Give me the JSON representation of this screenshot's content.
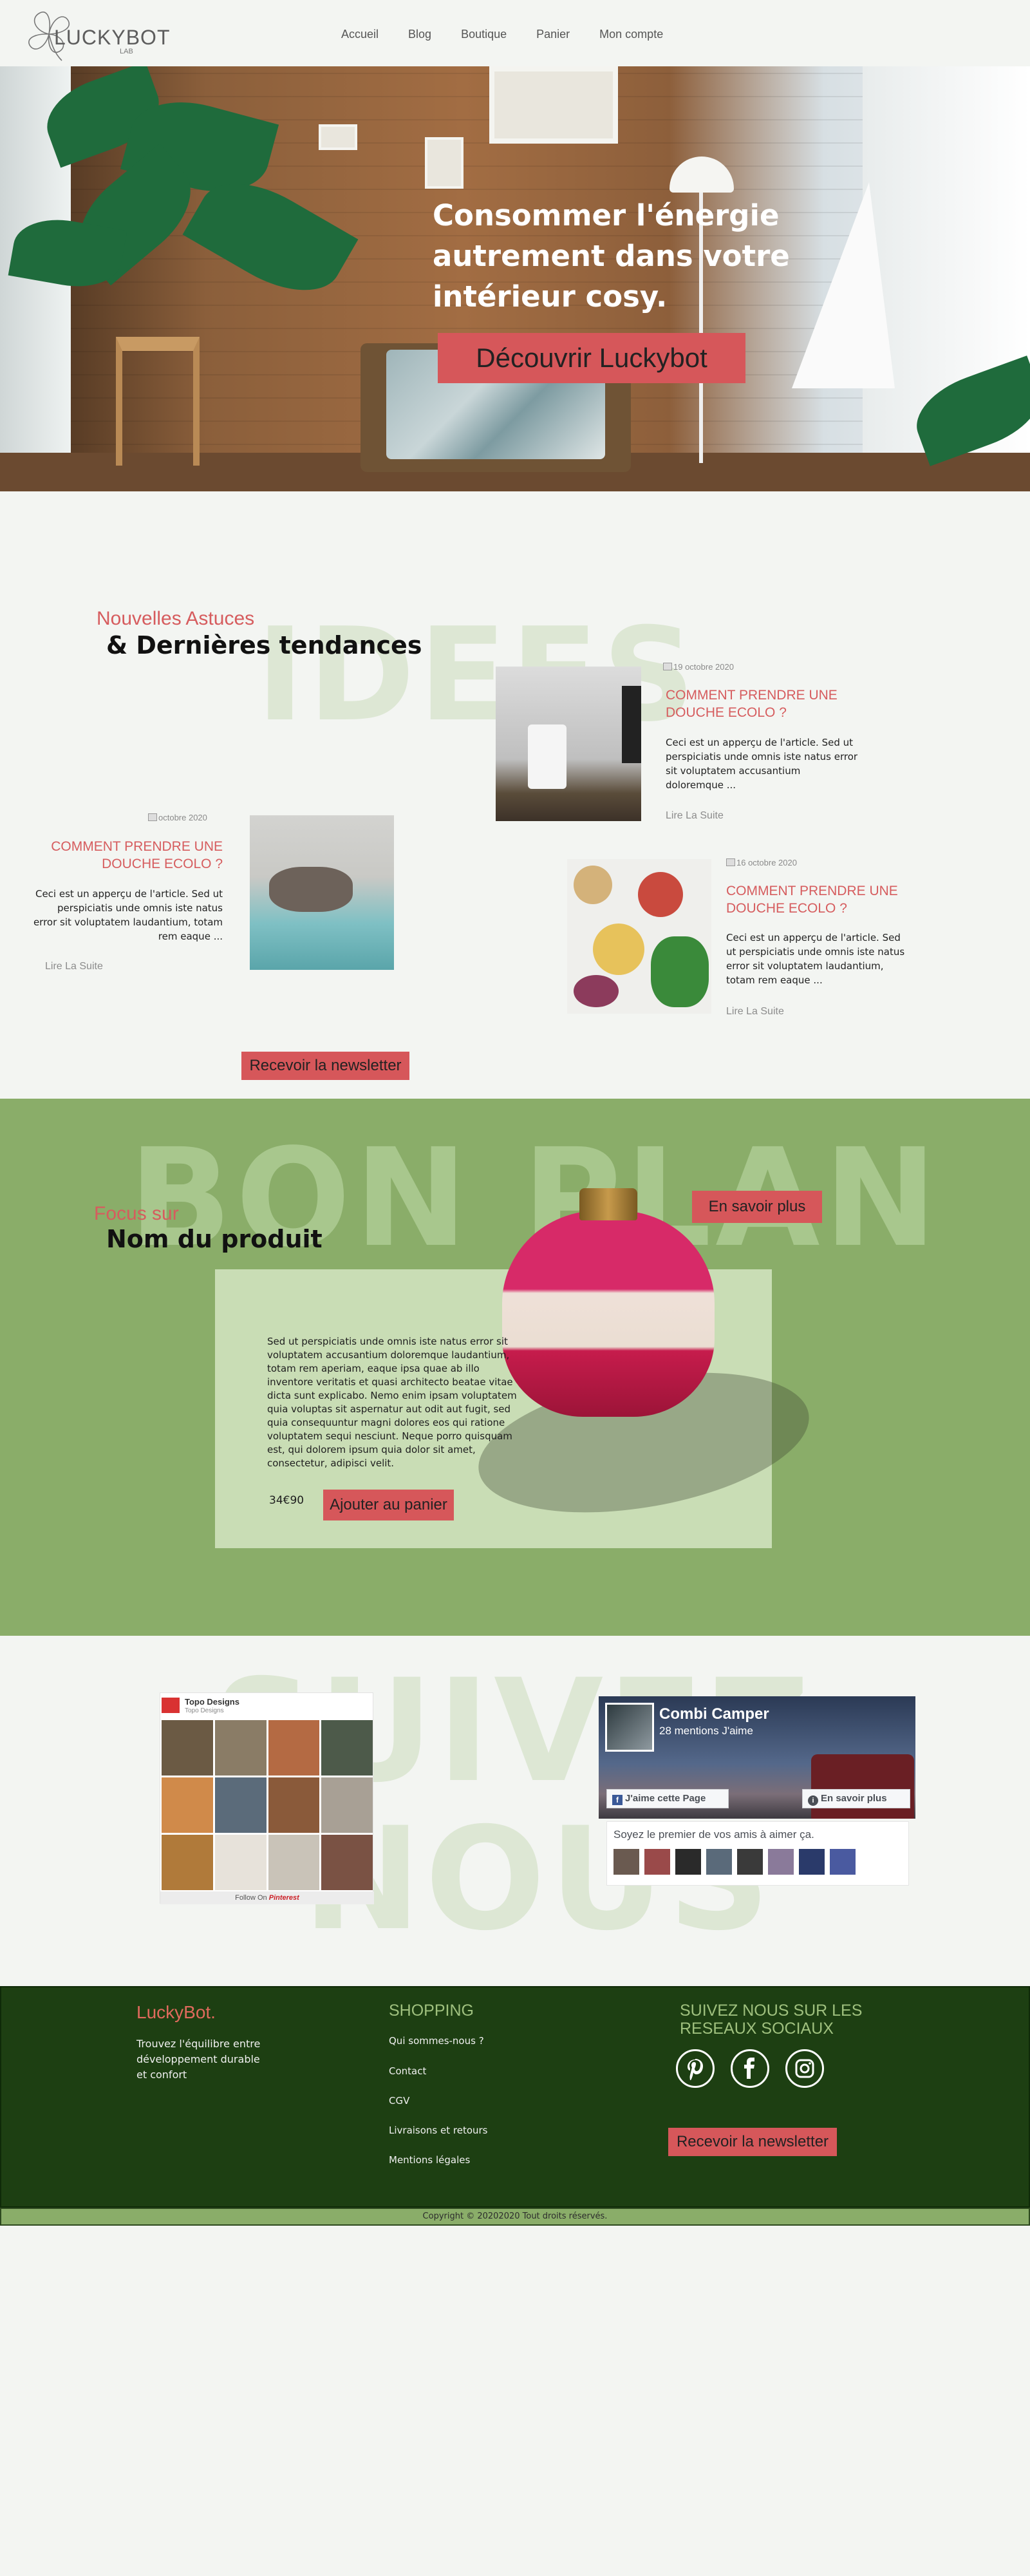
{
  "header": {
    "logo_text": "LUCKYBOT",
    "logo_sub": "LAB",
    "nav": [
      {
        "label": "Accueil"
      },
      {
        "label": "Blog"
      },
      {
        "label": "Boutique"
      },
      {
        "label": "Panier"
      },
      {
        "label": "Mon compte"
      }
    ]
  },
  "hero": {
    "title": "Consommer l'énergie autrement dans votre intérieur cosy.",
    "cta": "Découvrir Luckybot"
  },
  "ideas": {
    "bg_word": "IDEES",
    "kicker": "Nouvelles Astuces",
    "title": "& Dernières tendances",
    "newsletter_button": "Recevoir la newsletter",
    "articles": [
      {
        "date": "19 octobre 2020",
        "title": "COMMENT PRENDRE UNE DOUCHE ECOLO ?",
        "excerpt": "Ceci est un apperçu de l'article. Sed ut perspiciatis unde omnis iste natus error sit voluptatem accusantium doloremque  ...",
        "link": "Lire La Suite"
      },
      {
        "date": "octobre 2020",
        "title": "COMMENT PRENDRE UNE DOUCHE ECOLO ?",
        "excerpt": "Ceci est un apperçu de l'article. Sed ut perspiciatis unde omnis iste natus error sit voluptatem laudantium, totam rem eaque ...",
        "link": "Lire La Suite"
      },
      {
        "date": "16 octobre 2020",
        "title": "COMMENT PRENDRE UNE DOUCHE ECOLO ?",
        "excerpt": "Ceci est un apperçu de l'article. Sed ut perspiciatis unde omnis iste natus error sit voluptatem laudantium, totam rem eaque ...",
        "link": "Lire La Suite"
      }
    ]
  },
  "bonplan": {
    "bg_word": "BON PLAN",
    "kicker": "Focus sur",
    "title": "Nom du produit",
    "more_button": "En savoir plus",
    "description": "Sed ut perspiciatis unde omnis iste natus error sit voluptatem accusantium doloremque laudantium, totam rem aperiam, eaque ipsa quae ab illo inventore veritatis et quasi architecto beatae vitae dicta sunt explicabo. Nemo enim ipsam voluptatem quia voluptas sit aspernatur aut odit aut fugit, sed quia consequuntur magni dolores eos qui ratione voluptatem sequi nesciunt. Neque porro quisquam est, qui dolorem ipsum quia dolor sit amet, consectetur, adipisci velit.",
    "price": "34€90",
    "add_to_cart": "Ajouter au panier"
  },
  "social": {
    "bg_word_1": "SUIVEZ",
    "bg_word_2": "NOUS",
    "pinterest": {
      "name": "Topo Designs",
      "sub": "Topo Designs",
      "footer_prefix": "Follow On",
      "footer_brand": "Pinterest"
    },
    "facebook": {
      "page_name": "Combi Camper",
      "likes": "28 mentions J'aime",
      "like_button": "J'aime cette Page",
      "more_button": "En savoir plus",
      "friends_text": "Soyez le premier de vos amis à aimer ça."
    }
  },
  "footer": {
    "brand": "LuckyBot.",
    "description": "Trouvez l'équilibre entre développement durable et confort",
    "shopping_heading": "SHOPPING",
    "links": [
      {
        "label": "Qui sommes-nous ?"
      },
      {
        "label": "Contact"
      },
      {
        "label": "CGV"
      },
      {
        "label": "Livraisons et retours"
      },
      {
        "label": "Mentions légales"
      }
    ],
    "social_heading": "SUIVEZ NOUS SUR LES RESEAUX SOCIAUX",
    "social_icons": [
      "pinterest-icon",
      "facebook-icon",
      "instagram-icon"
    ],
    "newsletter_button": "Recevoir la newsletter",
    "copyright": "Copyright © 20202020 Tout droits réservés."
  },
  "colors": {
    "accent_red": "#d6575a",
    "bonplan_green": "#8aad69",
    "footer_green": "#1d3f12",
    "background": "#f3f5f2"
  }
}
